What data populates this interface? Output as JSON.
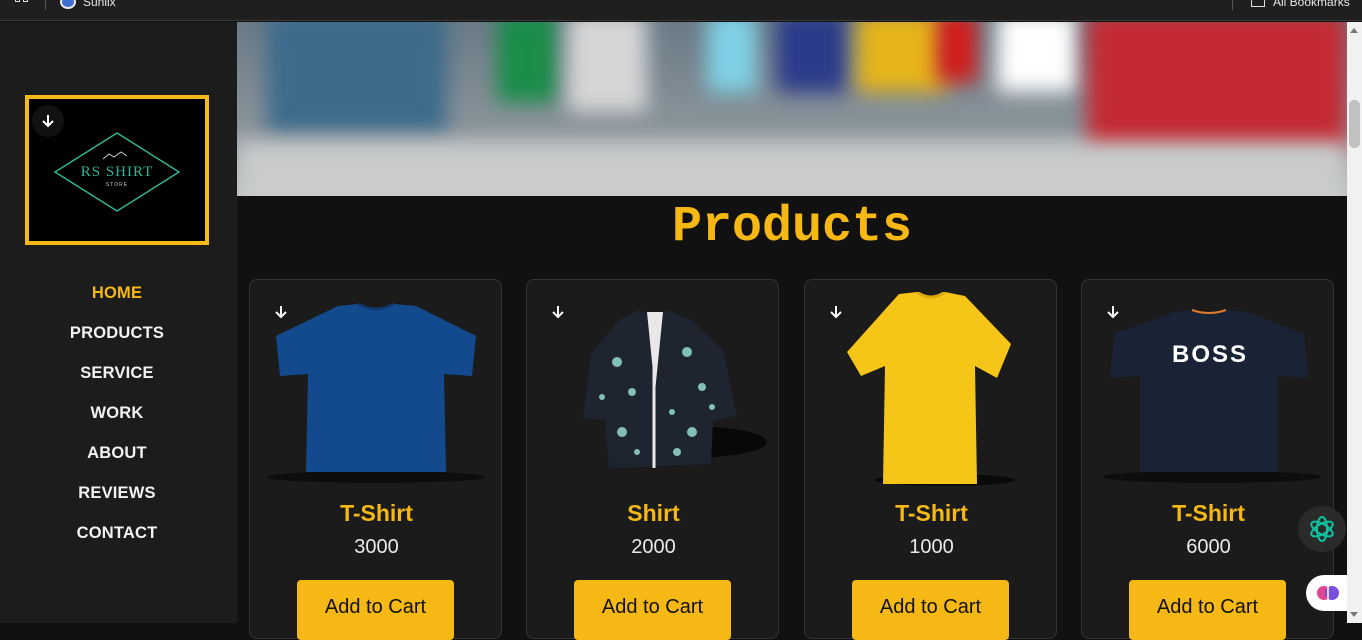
{
  "browser": {
    "bookmark_label": "Sunlix",
    "all_bookmarks_label": "All Bookmarks"
  },
  "sidebar": {
    "logo": {
      "line1": "RS SHIRT",
      "line2": "STORE"
    },
    "nav": [
      {
        "label": "HOME",
        "active": true
      },
      {
        "label": "PRODUCTS",
        "active": false
      },
      {
        "label": "SERVICE",
        "active": false
      },
      {
        "label": "WORK",
        "active": false
      },
      {
        "label": "ABOUT",
        "active": false
      },
      {
        "label": "REVIEWS",
        "active": false
      },
      {
        "label": "CONTACT",
        "active": false
      }
    ]
  },
  "products": {
    "title": "Products",
    "items": [
      {
        "name": "T-Shirt",
        "price": "3000",
        "button": "Add to Cart",
        "image": "blue-tshirt",
        "color": "#134a8e"
      },
      {
        "name": "Shirt",
        "price": "2000",
        "button": "Add to Cart",
        "image": "floral-shirt",
        "color": "#1e2430"
      },
      {
        "name": "T-Shirt",
        "price": "1000",
        "button": "Add to Cart",
        "image": "yellow-tshirt",
        "color": "#f5c518"
      },
      {
        "name": "T-Shirt",
        "price": "6000",
        "button": "Add to Cart",
        "image": "boss-tshirt",
        "color": "#1a2236",
        "print": "BOSS"
      }
    ]
  },
  "theme": {
    "accent": "#f6b814",
    "background": "#111111",
    "sidebar": "#1c1c1c"
  }
}
